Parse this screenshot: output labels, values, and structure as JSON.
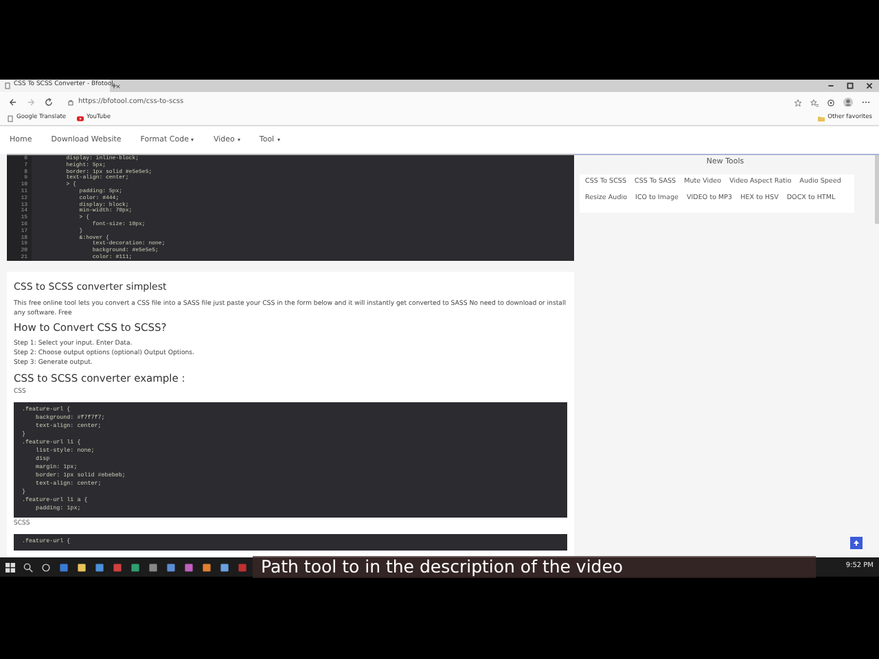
{
  "browser": {
    "tab_title": "CSS To SCSS Converter - Bfotool",
    "url": "https://bfotool.com/css-to-scss",
    "bookmarks": [
      "Google Translate",
      "YouTube"
    ],
    "other_favorites": "Other favorites"
  },
  "site_nav": [
    {
      "label": "Home",
      "dropdown": false
    },
    {
      "label": "Download Website",
      "dropdown": false
    },
    {
      "label": "Format Code",
      "dropdown": true
    },
    {
      "label": "Video",
      "dropdown": true
    },
    {
      "label": "Tool",
      "dropdown": true
    }
  ],
  "editor": {
    "lines": [
      {
        "number": "6",
        "code": "        display: inline-block;"
      },
      {
        "number": "7",
        "code": "        height: 5px;"
      },
      {
        "number": "8",
        "code": "        border: 1px solid #e5e5e5;"
      },
      {
        "number": "9",
        "code": "        text-align: center;"
      },
      {
        "number": "10",
        "code": "        > {"
      },
      {
        "number": "11",
        "code": "            padding: 5px;"
      },
      {
        "number": "12",
        "code": "            color: #444;"
      },
      {
        "number": "13",
        "code": "            display: block;"
      },
      {
        "number": "14",
        "code": "            min-width: 70px;"
      },
      {
        "number": "15",
        "code": "            > {"
      },
      {
        "number": "16",
        "code": "                font-size: 10px;"
      },
      {
        "number": "17",
        "code": "            }"
      },
      {
        "number": "18",
        "code": "            &:hover {"
      },
      {
        "number": "19",
        "code": "                text-decoration: none;"
      },
      {
        "number": "20",
        "code": "                background: #e5e5e5;"
      },
      {
        "number": "21",
        "code": "                color: #111;"
      }
    ]
  },
  "article": {
    "title": "CSS to SCSS converter simplest",
    "intro": "This free online tool lets you convert a CSS file into a SASS file just paste your CSS in the form below and it will instantly get converted to SASS No need to download or install any software. Free",
    "how_heading": "How to Convert CSS to SCSS?",
    "steps": [
      "Step 1: Select your input. Enter Data.",
      "Step 2: Choose output options (optional) Output Options.",
      "Step 3: Generate output."
    ],
    "examples_heading": "CSS to SCSS converter example :",
    "css_label": "CSS",
    "css_code": [
      ".feature-url {",
      "    background: #f7f7f7;",
      "    text-align: center;",
      "}",
      ".feature-url li {",
      "    list-style: none;",
      "    disp",
      "    margin: 1px;",
      "    border: 1px solid #ebebeb;",
      "    text-align: center;",
      "}",
      ".feature-url li a {",
      "    padding: 1px;"
    ],
    "scss_label": "SCSS",
    "scss_code": [
      ".feature-url {"
    ]
  },
  "sidebar": {
    "title": "New Tools",
    "tools": [
      "CSS To SCSS",
      "CSS To SASS",
      "Mute Video",
      "Video Aspect Ratio",
      "Audio Speed",
      "Resize Audio",
      "ICO to Image",
      "VIDEO to MP3",
      "HEX to HSV",
      "DOCX to HTML"
    ]
  },
  "caption": "Path tool to in the description of the video",
  "taskbar": {
    "clock": "9:52 PM"
  }
}
